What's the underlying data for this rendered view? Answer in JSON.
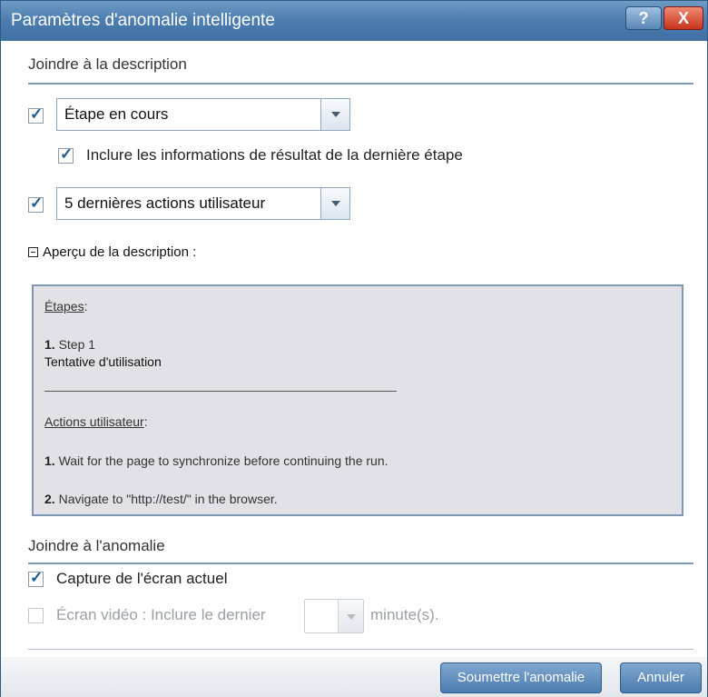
{
  "window": {
    "title": "Paramètres d'anomalie intelligente",
    "help_label": "?",
    "close_label": "X"
  },
  "description_section": {
    "title": "Joindre à la description",
    "step_dropdown_value": "Étape en cours",
    "include_result_label": "Inclure les informations de résultat de la dernière étape",
    "actions_dropdown_value": "5 dernières actions utilisateur"
  },
  "preview": {
    "header": "Aperçu de la description :",
    "steps_heading": "Étapes",
    "steps_colon": ":",
    "step1_num": "1.",
    "step1_name": "Step 1",
    "step1_status": "Tentative d'utilisation",
    "actions_heading": "Actions utilisateur",
    "actions_colon": ":",
    "action1_num": "1.",
    "action1_text": "Wait for the page to synchronize before continuing the run.",
    "action2_num": "2.",
    "action2_text": "Navigate to \"http://test/\" in the browser."
  },
  "attach_section": {
    "title": "Joindre à l'anomalie",
    "capture_label": "Capture de l'écran actuel",
    "video_label": "Écran vidéo : Inclure le dernier",
    "video_unit": "minute(s)."
  },
  "footer": {
    "submit_label": "Soumettre l'anomalie",
    "cancel_label": "Annuler"
  },
  "checkbox_mark": "✓",
  "colors": {
    "titlebar": "#4e7fb1",
    "accent": "#1f5a92",
    "preview_bg": "#e2e1e8"
  }
}
